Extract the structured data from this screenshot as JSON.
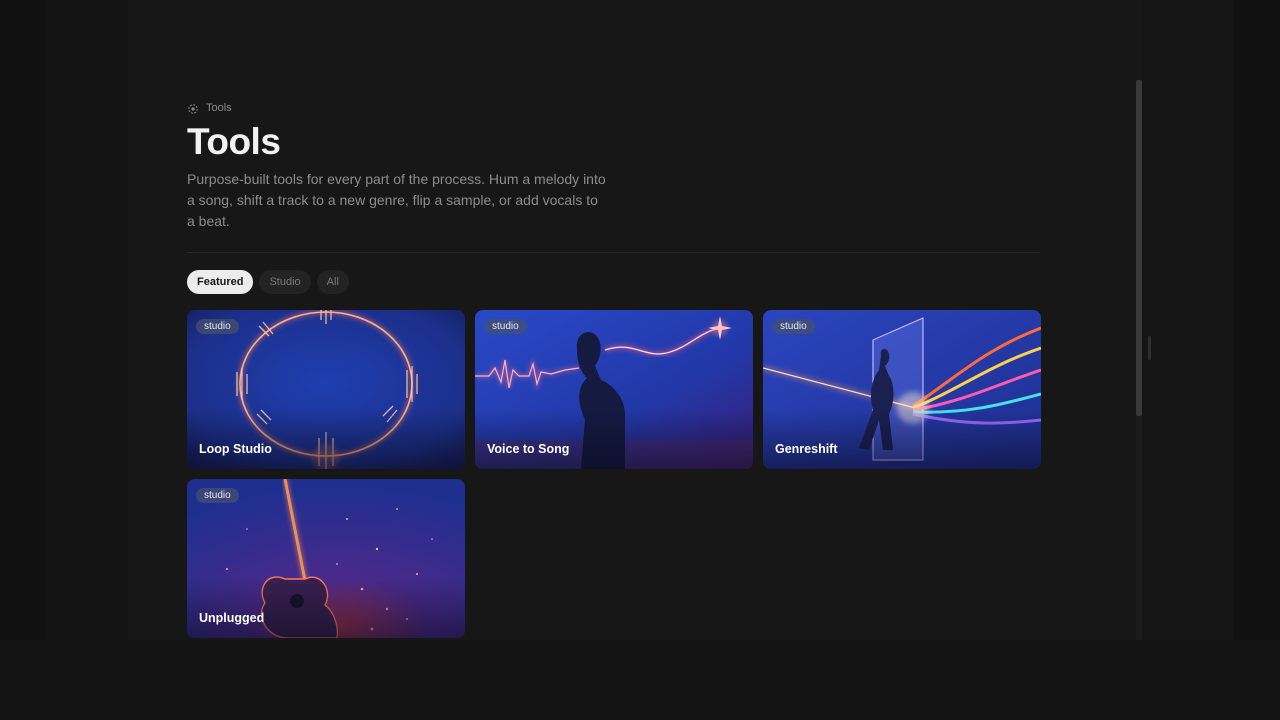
{
  "breadcrumb": {
    "label": "Tools",
    "icon": "tools-icon"
  },
  "page": {
    "title": "Tools",
    "description": "Purpose-built tools for every part of the process. Hum a melody into a song, shift a track to a new genre, flip a sample, or add vocals to a beat."
  },
  "filters": [
    {
      "label": "Featured",
      "active": true
    },
    {
      "label": "Studio",
      "active": false
    },
    {
      "label": "All",
      "active": false
    }
  ],
  "cards": [
    {
      "title": "Loop Studio",
      "tag": "studio"
    },
    {
      "title": "Voice to Song",
      "tag": "studio"
    },
    {
      "title": "Genreshift",
      "tag": "studio"
    },
    {
      "title": "Unplugged",
      "tag": "studio"
    }
  ],
  "colors": {
    "background": "#161616",
    "active_chip": "#ececec",
    "card_blue": "#2a3aa0",
    "neon_pink": "#ff5a8c"
  }
}
